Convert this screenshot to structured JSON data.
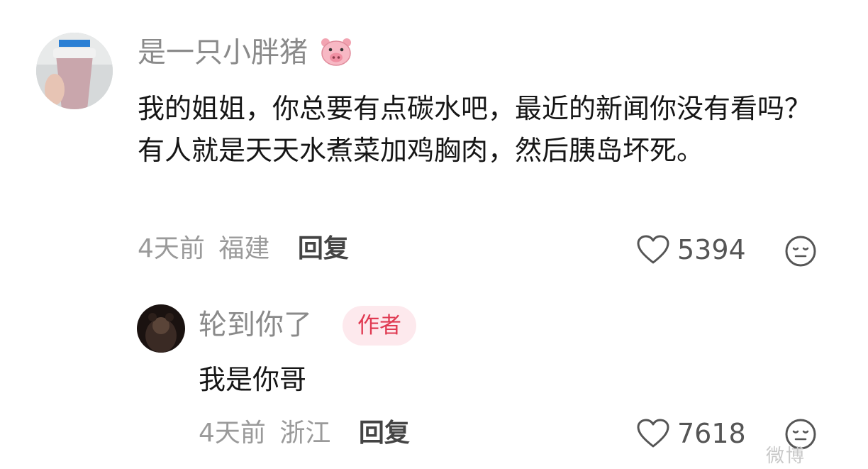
{
  "comment": {
    "username": "是一只小胖猪",
    "text": "我的姐姐，你总要有点碳水吧，最近的新闻你没有看吗？有人就是天天水煮菜加鸡胸肉，然后胰岛坏死。",
    "time": "4天前",
    "location": "福建",
    "reply_label": "回复",
    "likes": "5394"
  },
  "reply": {
    "username": "轮到你了",
    "badge": "作者",
    "text": "我是你哥",
    "time": "4天前",
    "location": "浙江",
    "reply_label": "回复",
    "likes": "7618"
  },
  "watermark": "微博"
}
